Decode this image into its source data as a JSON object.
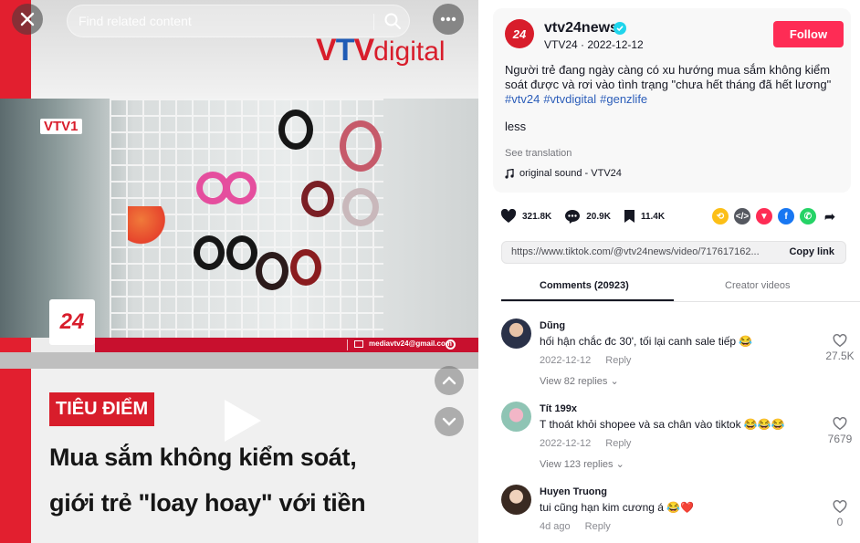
{
  "search": {
    "placeholder": "Find related content"
  },
  "video": {
    "brand_logo": "VTVdigital",
    "channel_badge": "VTV1",
    "logo_24": "24",
    "email": "mediavtv24@gmail.com",
    "tag": "TIÊU ĐIỂM",
    "headline_line1": "Mua sắm không kiểm soát,",
    "headline_line2": "giới trẻ \"loay hoay\" với tiền"
  },
  "post": {
    "channel_name": "vtv24news",
    "avatar_text": "24",
    "meta": "VTV24 · 2022-12-12",
    "follow_label": "Follow",
    "description": "Người trẻ đang ngày càng có xu hướng mua sắm không kiểm soát được và rơi vào tình trạng \"chưa hết tháng đã hết lương\"",
    "hashtags": [
      "#vtv24",
      "#vtvdigital",
      "#genzlife"
    ],
    "less_label": "less",
    "see_translation": "See translation",
    "sound": "original sound - VTV24"
  },
  "stats": {
    "likes": "321.8K",
    "comments": "20.9K",
    "saves": "11.4K"
  },
  "link": {
    "url": "https://www.tiktok.com/@vtv24news/video/717617162...",
    "copy_label": "Copy link"
  },
  "tabs": {
    "comments": "Comments (20923)",
    "creator_videos": "Creator videos"
  },
  "comments": [
    {
      "user": "Dũng",
      "text": "hối hận chắc đc 30', tối lại canh sale tiếp 😂",
      "date": "2022-12-12",
      "reply": "Reply",
      "view_replies": "View 82 replies ⌄",
      "likes": "27.5K"
    },
    {
      "user": "Tít 199x",
      "text": "T thoát khỏi shopee và sa chân vào tiktok 😂😂😂",
      "date": "2022-12-12",
      "reply": "Reply",
      "view_replies": "View 123 replies ⌄",
      "likes": "7679"
    },
    {
      "user": "Huyen Truong",
      "text": "tui cũng hạn kim cương á 😂❤️",
      "date": "4d ago",
      "reply": "Reply",
      "likes": "0"
    }
  ],
  "colors": {
    "accent": "#fe2c55",
    "hashtag": "#2b5db9",
    "vtv_red": "#d81d2b",
    "verified": "#20d5ec"
  },
  "icons": [
    "close-icon",
    "search-icon",
    "more-icon",
    "chevron-up-icon",
    "chevron-down-icon",
    "play-icon",
    "heart-icon",
    "comment-icon",
    "bookmark-icon",
    "music-note-icon",
    "verified-icon"
  ]
}
